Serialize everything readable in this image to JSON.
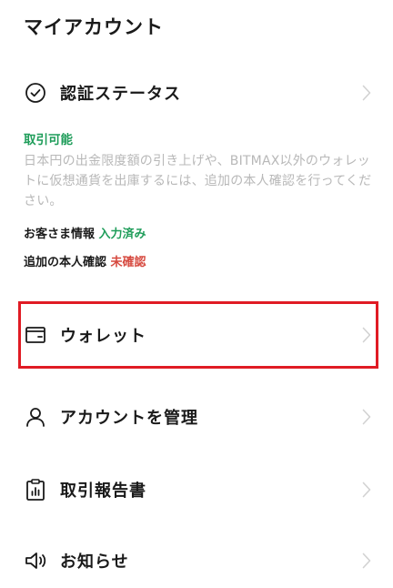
{
  "header": {
    "title": "マイアカウント"
  },
  "verification": {
    "label": "認証ステータス",
    "status": "取引可能",
    "description": "日本円の出金限度額の引き上げや、BITMAX以外のウォレットに仮想通貨を出庫するには、追加の本人確認を行ってください。",
    "customer_info_label": "お客さま情報",
    "customer_info_status": "入力済み",
    "additional_check_label": "追加の本人確認",
    "additional_check_status": "未確認"
  },
  "menu": {
    "wallet": "ウォレット",
    "account": "アカウントを管理",
    "reports": "取引報告書",
    "news": "お知らせ"
  },
  "colors": {
    "accent_green": "#1f9d5a",
    "alert_red": "#d6483e",
    "highlight_red": "#e01b24",
    "muted_text": "#b8b8b8"
  }
}
